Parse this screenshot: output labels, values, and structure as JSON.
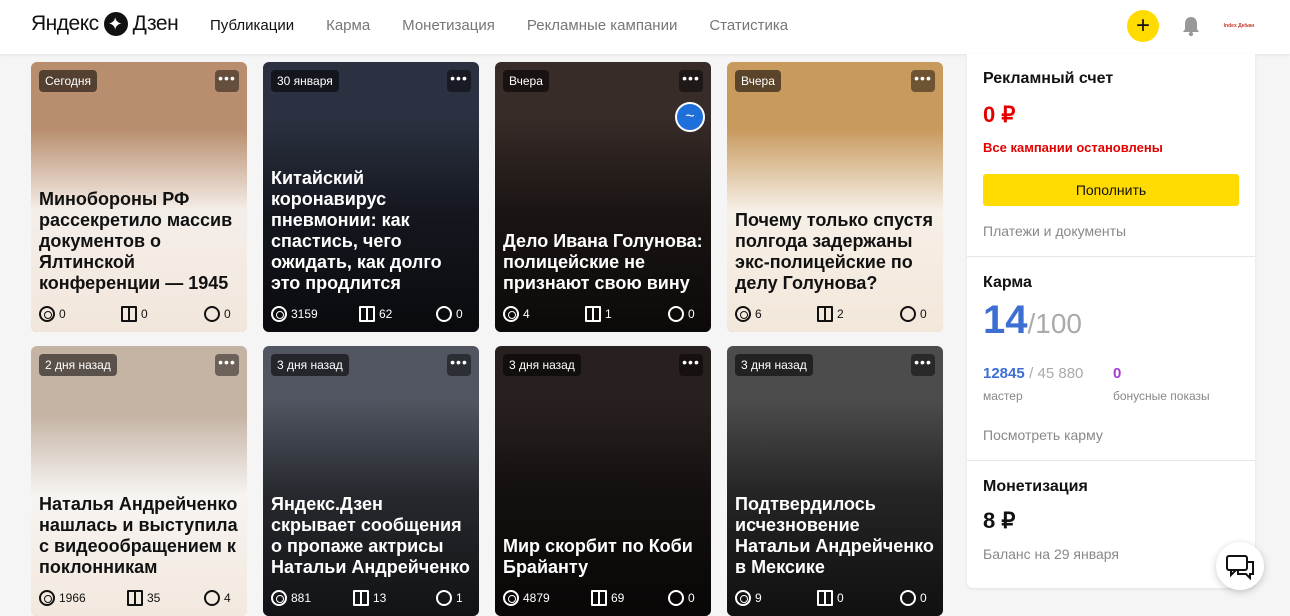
{
  "header": {
    "logo_left": "Яндекс",
    "logo_right": "Дзен",
    "nav": [
      "Публикации",
      "Карма",
      "Монетизация",
      "Рекламные кампании",
      "Статистика"
    ],
    "active_nav": "Публикации",
    "plus_label": "+",
    "avatar_label": "Index Днѣвн"
  },
  "cards": [
    {
      "date": "Сегодня",
      "title": "Минобороны РФ рассекретило массив документов о Ялтинской конференции — 1945",
      "views": "0",
      "reads": "0",
      "comments": "0",
      "theme": "light",
      "bg": "#b98e6e"
    },
    {
      "date": "30 января",
      "title": "Китайский коронавирус пневмонии: как спастись, чего ожидать, как долго это продлится",
      "views": "3159",
      "reads": "62",
      "comments": "0",
      "theme": "dark",
      "bg": "#2e3445"
    },
    {
      "date": "Вчера",
      "title": "Дело Ивана Голунова: полицейские не признают свою вину",
      "views": "4",
      "reads": "1",
      "comments": "0",
      "theme": "dark",
      "bg": "#3a2e2a"
    },
    {
      "date": "Вчера",
      "title": "Почему только спустя полгода задержаны экс-полицейские по делу Голунова?",
      "views": "6",
      "reads": "2",
      "comments": "0",
      "theme": "light",
      "bg": "#c89a5e"
    },
    {
      "date": "2 дня назад",
      "title": "Наталья Андрейченко нашлась и выступила с видеообращением к поклонникам",
      "views": "1966",
      "reads": "35",
      "comments": "4",
      "theme": "light",
      "bg": "#c5b3a4"
    },
    {
      "date": "3 дня назад",
      "title": "Яндекс.Дзен скрывает сообщения о пропаже актрисы Натальи Андрейченко",
      "views": "881",
      "reads": "13",
      "comments": "1",
      "theme": "dark",
      "bg": "#555a66"
    },
    {
      "date": "3 дня назад",
      "title": "Мир скорбит по Коби Брайанту",
      "views": "4879",
      "reads": "69",
      "comments": "0",
      "theme": "dark",
      "bg": "#2a2220"
    },
    {
      "date": "3 дня назад",
      "title": "Подтвердилось исчезновение Натальи Андрейченко в Мексике",
      "views": "9",
      "reads": "0",
      "comments": "0",
      "theme": "dark",
      "bg": "#505050"
    }
  ],
  "sidebar": {
    "ads": {
      "title": "Рекламный счет",
      "balance": "0 ₽",
      "status": "Все кампании остановлены",
      "topup": "Пополнить",
      "docs": "Платежи и документы"
    },
    "karma": {
      "title": "Карма",
      "value": "14",
      "max": "/100",
      "score": "12845",
      "score_max": "/ 45 880",
      "score_label": "мастер",
      "bonus": "0",
      "bonus_label": "бонусные показы",
      "link": "Посмотреть карму"
    },
    "monetization": {
      "title": "Монетизация",
      "balance": "8 ₽",
      "note": "Баланс на 29 января"
    }
  },
  "more_label": "•••"
}
